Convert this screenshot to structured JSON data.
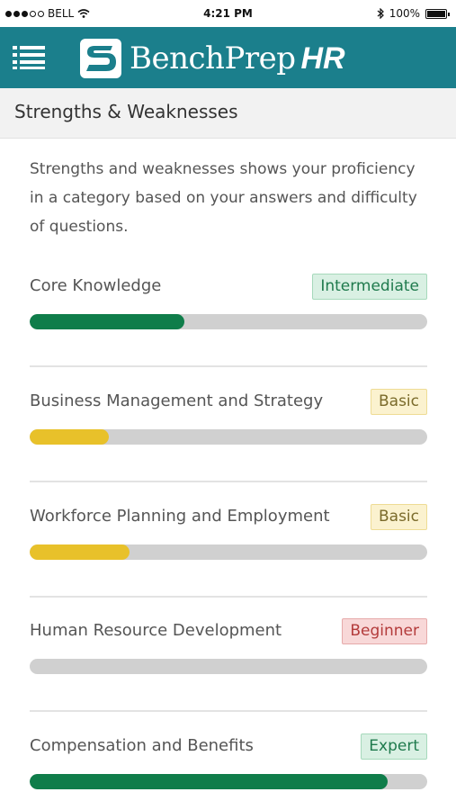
{
  "status_bar": {
    "carrier": "BELL",
    "time": "4:21 PM",
    "battery": "100%"
  },
  "header": {
    "brand_name": "BenchPrep",
    "brand_suffix": "HR",
    "menu_icon": "list-menu-icon",
    "color": "#1b7f8c"
  },
  "page": {
    "title": "Strengths & Weaknesses",
    "intro": "Strengths and weaknesses shows your proficiency in a category based on your answers and difficulty of questions."
  },
  "categories": [
    {
      "name": "Core Knowledge",
      "level": "Intermediate",
      "progress": 0.39,
      "color": "green"
    },
    {
      "name": "Business Management and Strategy",
      "level": "Basic",
      "progress": 0.2,
      "color": "yellow"
    },
    {
      "name": "Workforce Planning and Employment",
      "level": "Basic",
      "progress": 0.25,
      "color": "yellow"
    },
    {
      "name": "Human Resource Development",
      "level": "Beginner",
      "progress": 0.0,
      "color": "yellow"
    },
    {
      "name": "Compensation and Benefits",
      "level": "Expert",
      "progress": 0.9,
      "color": "green"
    }
  ]
}
